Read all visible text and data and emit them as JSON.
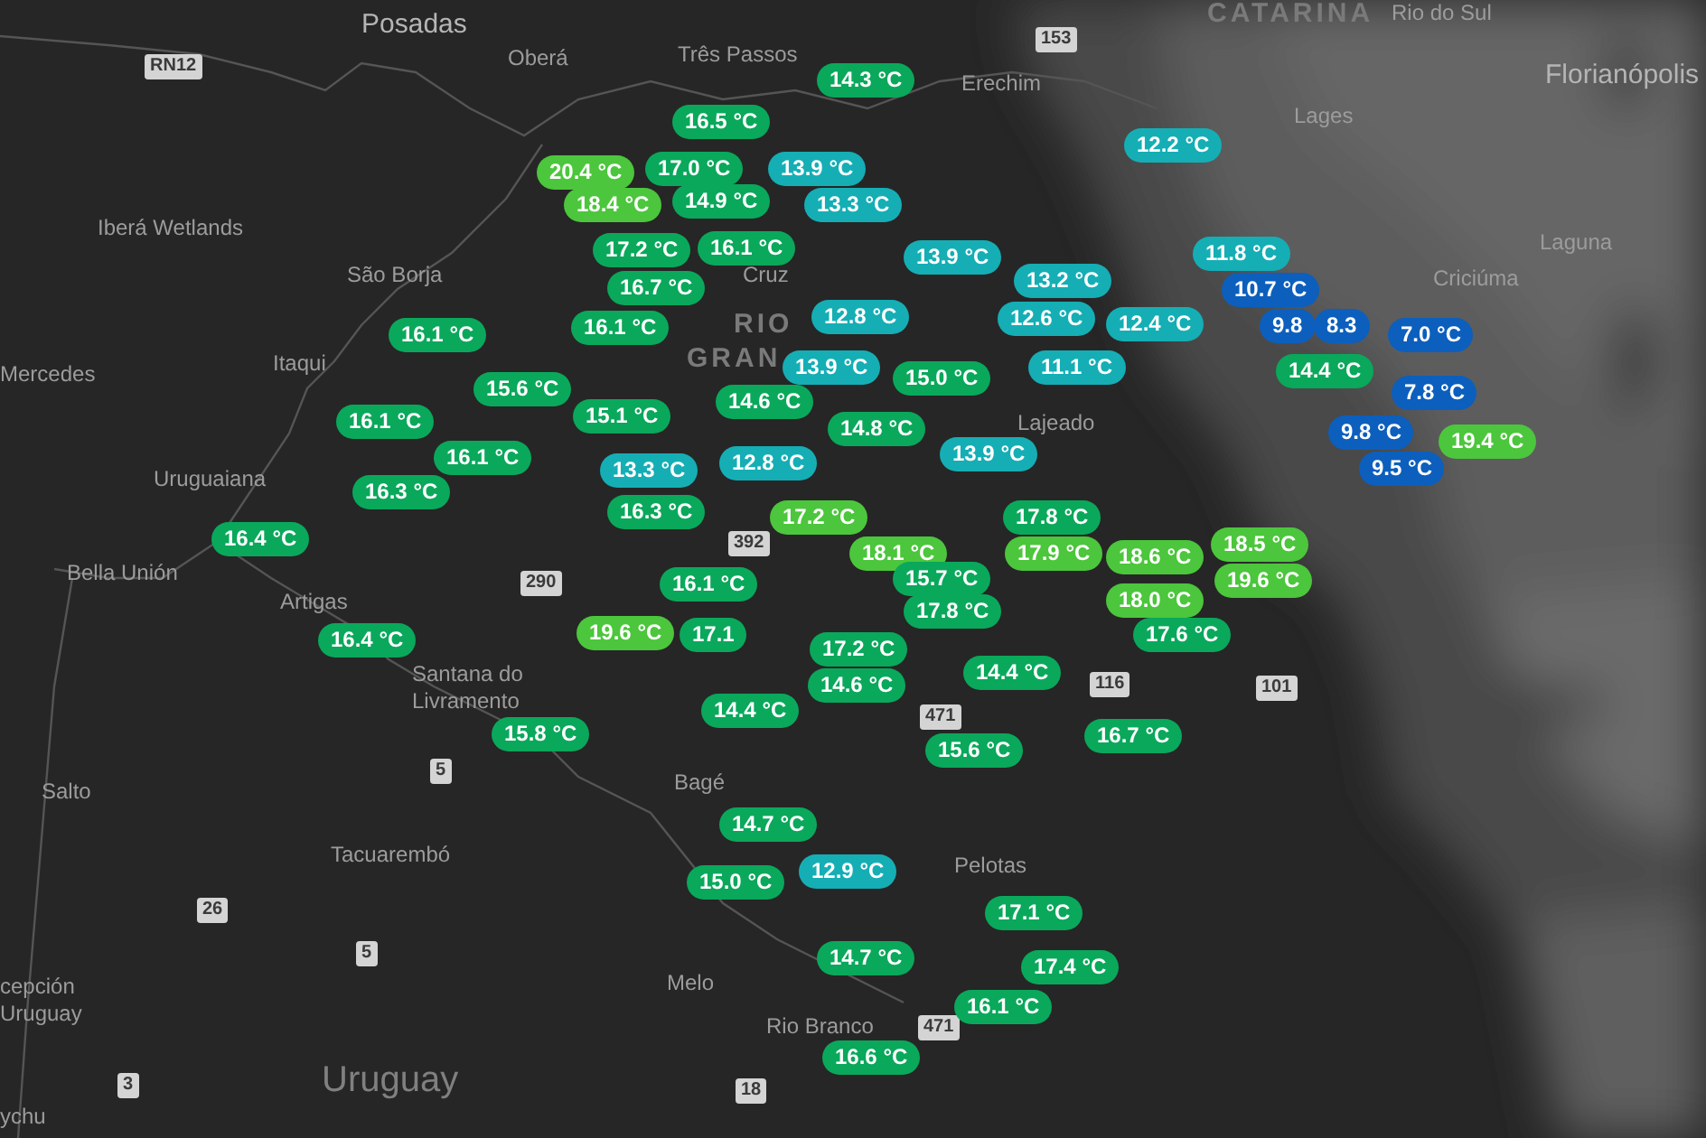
{
  "map": {
    "place_labels": [
      {
        "text": "Posadas",
        "kind": "major"
      },
      {
        "text": "Oberá",
        "kind": "city"
      },
      {
        "text": "Três Passos",
        "kind": "city"
      },
      {
        "text": "Erechim",
        "kind": "city"
      },
      {
        "text": "CATARINA",
        "kind": "region"
      },
      {
        "text": "Rio do Sul",
        "kind": "city"
      },
      {
        "text": "Florianópolis",
        "kind": "major"
      },
      {
        "text": "Lages",
        "kind": "city"
      },
      {
        "text": "Laguna",
        "kind": "city"
      },
      {
        "text": "Criciúma",
        "kind": "city"
      },
      {
        "text": "Iberá Wetlands",
        "kind": "city"
      },
      {
        "text": "São Borja",
        "kind": "city"
      },
      {
        "text": "Mercedes",
        "kind": "city"
      },
      {
        "text": "Itaqui",
        "kind": "city"
      },
      {
        "text": "Cruz",
        "kind": "city"
      },
      {
        "text": "RIO",
        "kind": "region"
      },
      {
        "text": "GRAN",
        "kind": "region"
      },
      {
        "text": "Lajeado",
        "kind": "city"
      },
      {
        "text": "Uruguaiana",
        "kind": "city"
      },
      {
        "text": "Bella Unión",
        "kind": "city"
      },
      {
        "text": "Artigas",
        "kind": "city"
      },
      {
        "text": "Santana do Livramento",
        "kind": "city"
      },
      {
        "text": "Salto",
        "kind": "city"
      },
      {
        "text": "Tacuarembó",
        "kind": "city"
      },
      {
        "text": "Bagé",
        "kind": "city"
      },
      {
        "text": "Pelotas",
        "kind": "city"
      },
      {
        "text": "Melo",
        "kind": "city"
      },
      {
        "text": "cepción",
        "kind": "city"
      },
      {
        "text": "Uruguay",
        "kind": "city"
      },
      {
        "text": "Rio Branco",
        "kind": "city"
      },
      {
        "text": "Uruguay",
        "kind": "country"
      },
      {
        "text": "ychu",
        "kind": "city"
      }
    ],
    "road_shields": [
      {
        "text": "RN12"
      },
      {
        "text": "153"
      },
      {
        "text": "392"
      },
      {
        "text": "290"
      },
      {
        "text": "116"
      },
      {
        "text": "101"
      },
      {
        "text": "471"
      },
      {
        "text": "5"
      },
      {
        "text": "26"
      },
      {
        "text": "5"
      },
      {
        "text": "471"
      },
      {
        "text": "3"
      },
      {
        "text": "18"
      }
    ],
    "temperature_markers": [
      {
        "text": "14.3 °C",
        "color": "#0aa85b"
      },
      {
        "text": "16.5 °C",
        "color": "#0aa85b"
      },
      {
        "text": "12.2 °C",
        "color": "#15aeb5"
      },
      {
        "text": "20.4 °C",
        "color": "#4cc63c"
      },
      {
        "text": "17.0 °C",
        "color": "#0aa85b"
      },
      {
        "text": "13.9 °C",
        "color": "#15aeb5"
      },
      {
        "text": "18.4 °C",
        "color": "#4cc63c"
      },
      {
        "text": "14.9 °C",
        "color": "#0aa85b"
      },
      {
        "text": "13.3 °C",
        "color": "#15aeb5"
      },
      {
        "text": "17.2 °C",
        "color": "#0aa85b"
      },
      {
        "text": "16.1 °C",
        "color": "#0aa85b"
      },
      {
        "text": "13.9 °C",
        "color": "#15aeb5"
      },
      {
        "text": "11.8 °C",
        "color": "#15aeb5"
      },
      {
        "text": "16.7 °C",
        "color": "#0aa85b"
      },
      {
        "text": "13.2 °C",
        "color": "#15aeb5"
      },
      {
        "text": "10.7 °C",
        "color": "#0c5fbd"
      },
      {
        "text": "16.1 °C",
        "color": "#0aa85b"
      },
      {
        "text": "16.1 °C",
        "color": "#0aa85b"
      },
      {
        "text": "12.8 °C",
        "color": "#15aeb5"
      },
      {
        "text": "12.6 °C",
        "color": "#15aeb5"
      },
      {
        "text": "12.4 °C",
        "color": "#15aeb5"
      },
      {
        "text": "9.8",
        "color": "#0c5fbd"
      },
      {
        "text": "8.3",
        "color": "#0c5fbd"
      },
      {
        "text": "7.0 °C",
        "color": "#0c5fbd"
      },
      {
        "text": "13.9 °C",
        "color": "#15aeb5"
      },
      {
        "text": "15.0 °C",
        "color": "#0aa85b"
      },
      {
        "text": "11.1 °C",
        "color": "#15aeb5"
      },
      {
        "text": "14.4 °C",
        "color": "#0aa85b"
      },
      {
        "text": "15.6 °C",
        "color": "#0aa85b"
      },
      {
        "text": "14.6 °C",
        "color": "#0aa85b"
      },
      {
        "text": "7.8 °C",
        "color": "#0c5fbd"
      },
      {
        "text": "16.1 °C",
        "color": "#0aa85b"
      },
      {
        "text": "15.1 °C",
        "color": "#0aa85b"
      },
      {
        "text": "14.8 °C",
        "color": "#0aa85b"
      },
      {
        "text": "9.8 °C",
        "color": "#0c5fbd"
      },
      {
        "text": "19.4 °C",
        "color": "#4cc63c"
      },
      {
        "text": "16.1 °C",
        "color": "#0aa85b"
      },
      {
        "text": "13.3 °C",
        "color": "#15aeb5"
      },
      {
        "text": "12.8 °C",
        "color": "#15aeb5"
      },
      {
        "text": "13.9 °C",
        "color": "#15aeb5"
      },
      {
        "text": "9.5 °C",
        "color": "#0c5fbd"
      },
      {
        "text": "16.3 °C",
        "color": "#0aa85b"
      },
      {
        "text": "16.3 °C",
        "color": "#0aa85b"
      },
      {
        "text": "17.2 °C",
        "color": "#4cc63c"
      },
      {
        "text": "17.8 °C",
        "color": "#0aa85b"
      },
      {
        "text": "16.4 °C",
        "color": "#0aa85b"
      },
      {
        "text": "18.1 °C",
        "color": "#4cc63c"
      },
      {
        "text": "17.9 °C",
        "color": "#4cc63c"
      },
      {
        "text": "18.6 °C",
        "color": "#4cc63c"
      },
      {
        "text": "18.5 °C",
        "color": "#4cc63c"
      },
      {
        "text": "16.1 °C",
        "color": "#0aa85b"
      },
      {
        "text": "15.7 °C",
        "color": "#0aa85b"
      },
      {
        "text": "19.6 °C",
        "color": "#4cc63c"
      },
      {
        "text": "18.0 °C",
        "color": "#4cc63c"
      },
      {
        "text": "17.8 °C",
        "color": "#0aa85b"
      },
      {
        "text": "16.4 °C",
        "color": "#0aa85b"
      },
      {
        "text": "19.6 °C",
        "color": "#4cc63c"
      },
      {
        "text": "17.1",
        "color": "#0aa85b"
      },
      {
        "text": "17.2 °C",
        "color": "#0aa85b"
      },
      {
        "text": "17.6 °C",
        "color": "#0aa85b"
      },
      {
        "text": "14.6 °C",
        "color": "#0aa85b"
      },
      {
        "text": "14.4 °C",
        "color": "#0aa85b"
      },
      {
        "text": "14.4 °C",
        "color": "#0aa85b"
      },
      {
        "text": "15.8 °C",
        "color": "#0aa85b"
      },
      {
        "text": "15.6 °C",
        "color": "#0aa85b"
      },
      {
        "text": "16.7 °C",
        "color": "#0aa85b"
      },
      {
        "text": "14.7 °C",
        "color": "#0aa85b"
      },
      {
        "text": "15.0 °C",
        "color": "#0aa85b"
      },
      {
        "text": "12.9 °C",
        "color": "#15aeb5"
      },
      {
        "text": "17.1 °C",
        "color": "#0aa85b"
      },
      {
        "text": "14.7 °C",
        "color": "#0aa85b"
      },
      {
        "text": "17.4 °C",
        "color": "#0aa85b"
      },
      {
        "text": "16.1 °C",
        "color": "#0aa85b"
      },
      {
        "text": "16.6 °C",
        "color": "#0aa85b"
      }
    ]
  }
}
